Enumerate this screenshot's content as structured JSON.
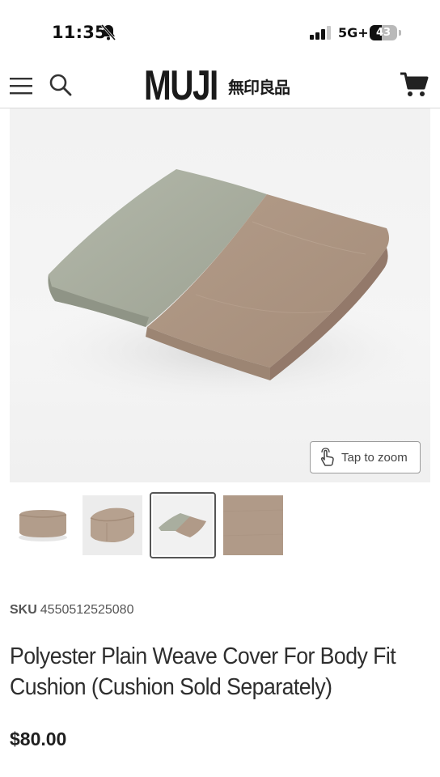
{
  "status_bar": {
    "time": "11:35",
    "network": "5G+",
    "battery_percent": 43,
    "battery_text": "43",
    "icons": [
      "bell-slash-icon",
      "signal-icon"
    ]
  },
  "header": {
    "logo_text": "MUJI",
    "logo_kanji": "無印良品",
    "icons": [
      "menu-icon",
      "search-icon",
      "cart-icon"
    ]
  },
  "gallery": {
    "zoom_label": "Tap to zoom",
    "thumbnails": [
      "cushion-cube-side",
      "cushion-cube-angle",
      "folded-cover",
      "fabric-swatch"
    ],
    "selected_index": 2,
    "colors": {
      "fabric_taupe": "#b09a88",
      "fabric_grey_green": "#a9ae9f"
    }
  },
  "product": {
    "sku_label": "SKU",
    "sku": "4550512525080",
    "title": "Polyester Plain Weave Cover For Body Fit Cushion (Cushion Sold Separately)",
    "price": "$80.00"
  }
}
